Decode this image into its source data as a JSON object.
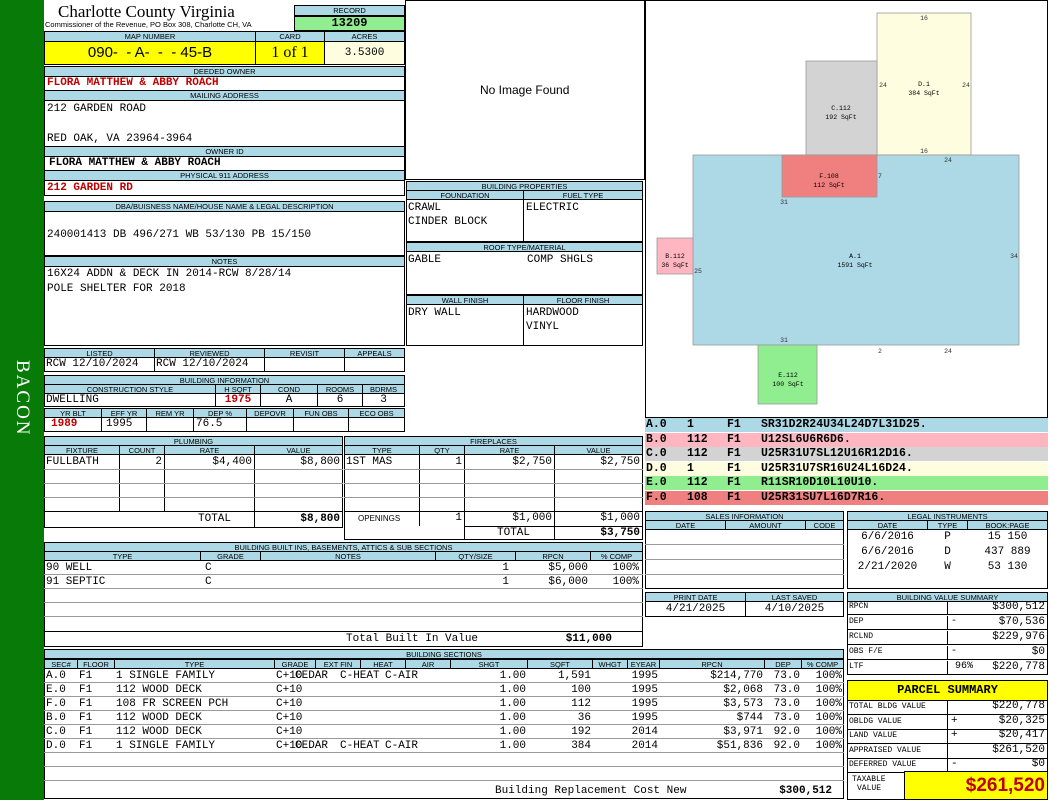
{
  "sidebar": {
    "label": "BACON"
  },
  "header": {
    "county": "Charlotte County Virginia",
    "address": "Commissioner of the Revenue, PO Box 308, Charlotte CH, VA",
    "record_label": "RECORD",
    "record": "13209"
  },
  "map": {
    "map_number_label": "MAP NUMBER",
    "map_number": "090-  - A-  -  - 45-B",
    "card_label": "CARD",
    "card": "1 of 1",
    "acres_label": "ACRES",
    "acres": "3.5300"
  },
  "deeded_owner": {
    "label": "DEEDED OWNER",
    "value": "FLORA MATTHEW & ABBY ROACH"
  },
  "mailing": {
    "label": "MAILING ADDRESS",
    "line1": "212 GARDEN ROAD",
    "line2": "RED OAK, VA 23964-3964"
  },
  "owner_id": {
    "label": "OWNER ID",
    "value": "FLORA MATTHEW & ABBY ROACH"
  },
  "physical": {
    "label": "PHYSICAL 911 ADDRESS",
    "value": "212 GARDEN RD"
  },
  "dba": {
    "label": "DBA/BUISNESS NAME/HOUSE NAME & LEGAL DESCRIPTION",
    "value": "240001413 DB 496/271 WB 53/130 PB 15/150"
  },
  "notes": {
    "label": "NOTES",
    "line1": "16X24 ADDN & DECK IN 2014-RCW 8/28/14",
    "line2": "POLE SHELTER FOR 2018"
  },
  "image": {
    "no_image": "No Image Found"
  },
  "building_props": {
    "label": "BUILDING PROPERTIES",
    "foundation_label": "FOUNDATION",
    "foundation": [
      "CRAWL",
      "CINDER BLOCK"
    ],
    "fuel_label": "FUEL TYPE",
    "fuel": "ELECTRIC",
    "roof_label": "ROOF TYPE/MATERIAL",
    "roof_type": "GABLE",
    "roof_material": "COMP SHGLS",
    "wall_label": "WALL FINISH",
    "wall": "DRY WALL",
    "floor_label": "FLOOR FINISH",
    "floor": [
      "HARDWOOD",
      "VINYL"
    ]
  },
  "review": {
    "listed_label": "LISTED",
    "listed": "RCW 12/10/2024",
    "reviewed_label": "REVIEWED",
    "reviewed": "RCW 12/10/2024",
    "revisit_label": "REVISIT",
    "appeals_label": "APPEALS"
  },
  "building_info": {
    "label": "BUILDING INFORMATION",
    "style_label": "CONSTRUCTION STYLE",
    "style": "DWELLING",
    "hsqft_label": "H SQFT",
    "hsqft": "1975",
    "cond_label": "COND",
    "cond": "A",
    "rooms_label": "ROOMS",
    "rooms": "6",
    "bdrms_label": "BDRMS",
    "bdrms": "3",
    "yrblt_label": "YR BLT",
    "yrblt": "1989",
    "effyr_label": "EFF YR",
    "effyr": "1995",
    "remyr_label": "REM YR",
    "dep_label": "DEP %",
    "dep": "76.5",
    "depovr_label": "DEPOVR",
    "funobs_label": "FUN OBS",
    "ecoobs_label": "ECO OBS"
  },
  "plumbing": {
    "label": "PLUMBING",
    "cols": [
      "FIXTURE",
      "COUNT",
      "RATE",
      "VALUE"
    ],
    "rows": [
      {
        "fixture": "FULLBATH",
        "count": "2",
        "rate": "$4,400",
        "value": "$8,800"
      }
    ],
    "total_label": "TOTAL",
    "total": "$8,800"
  },
  "fireplaces": {
    "label": "FIREPLACES",
    "cols": [
      "TYPE",
      "QTY",
      "RATE",
      "VALUE"
    ],
    "rows": [
      {
        "type": "1ST MAS",
        "qty": "1",
        "rate": "$2,750",
        "value": "$2,750"
      }
    ],
    "openings_label": "OPENINGS",
    "openings_qty": "1",
    "openings_rate": "$1,000",
    "openings_value": "$1,000",
    "total_label": "TOTAL",
    "total": "$3,750"
  },
  "builtins": {
    "label": "BUILDING BUILT INS, BASEMENTS, ATTICS & SUB SECTIONS",
    "cols": [
      "TYPE",
      "GRADE",
      "NOTES",
      "QTY/SIZE",
      "RPCN",
      "% COMP"
    ],
    "rows": [
      {
        "type": "90 WELL",
        "grade": "C",
        "notes": "",
        "qty": "1",
        "rpcn": "$5,000",
        "comp": "100%"
      },
      {
        "type": "91 SEPTIC",
        "grade": "C",
        "notes": "",
        "qty": "1",
        "rpcn": "$6,000",
        "comp": "100%"
      }
    ],
    "total_label": "Total Built In Value",
    "total": "$11,000"
  },
  "sections": {
    "label": "BUILDING SECTIONS",
    "cols": [
      "SEC#",
      "FLOOR",
      "TYPE",
      "GRADE",
      "EXT FIN",
      "HEAT",
      "AIR",
      "SHGT",
      "SQFT",
      "WHGT",
      "EYEAR",
      "RPCN",
      "DEP",
      "% COMP"
    ],
    "rows": [
      {
        "sec": "A.0",
        "floor": "F1",
        "type": "1 SINGLE FAMILY",
        "grade": "C+10",
        "ext": "CEDAR",
        "heat": "C-HEAT",
        "air": "C-AIR",
        "shgt": "1.00",
        "sqft": "1,591",
        "whgt": "",
        "eyear": "1995",
        "rpcn": "$214,770",
        "dep": "73.0",
        "comp": "100%"
      },
      {
        "sec": "E.0",
        "floor": "F1",
        "type": "112 WOOD DECK",
        "grade": "C+10",
        "ext": "",
        "heat": "",
        "air": "",
        "shgt": "1.00",
        "sqft": "100",
        "whgt": "",
        "eyear": "1995",
        "rpcn": "$2,068",
        "dep": "73.0",
        "comp": "100%"
      },
      {
        "sec": "F.0",
        "floor": "F1",
        "type": "108 FR SCREEN PCH",
        "grade": "C+10",
        "ext": "",
        "heat": "",
        "air": "",
        "shgt": "1.00",
        "sqft": "112",
        "whgt": "",
        "eyear": "1995",
        "rpcn": "$3,573",
        "dep": "73.0",
        "comp": "100%"
      },
      {
        "sec": "B.0",
        "floor": "F1",
        "type": "112 WOOD DECK",
        "grade": "C+10",
        "ext": "",
        "heat": "",
        "air": "",
        "shgt": "1.00",
        "sqft": "36",
        "whgt": "",
        "eyear": "1995",
        "rpcn": "$744",
        "dep": "73.0",
        "comp": "100%"
      },
      {
        "sec": "C.0",
        "floor": "F1",
        "type": "112 WOOD DECK",
        "grade": "C+10",
        "ext": "",
        "heat": "",
        "air": "",
        "shgt": "1.00",
        "sqft": "192",
        "whgt": "",
        "eyear": "2014",
        "rpcn": "$3,971",
        "dep": "92.0",
        "comp": "100%"
      },
      {
        "sec": "D.0",
        "floor": "F1",
        "type": "1 SINGLE FAMILY",
        "grade": "C+10",
        "ext": "CEDAR",
        "heat": "C-HEAT",
        "air": "C-AIR",
        "shgt": "1.00",
        "sqft": "384",
        "whgt": "",
        "eyear": "2014",
        "rpcn": "$51,836",
        "dep": "92.0",
        "comp": "100%"
      }
    ],
    "total_label": "Building Replacement Cost New",
    "total": "$300,512"
  },
  "sketch": {
    "areas": [
      {
        "id": "A.1",
        "sqft": "1591 SqFt",
        "color": "#add8e6"
      },
      {
        "id": "B.112",
        "sqft": "36 SqFt",
        "color": "#ffb6c1"
      },
      {
        "id": "C.112",
        "sqft": "192 SqFt",
        "color": "#d3d3d3"
      },
      {
        "id": "D.1",
        "sqft": "384 SqFt",
        "color": "#fffde0"
      },
      {
        "id": "E.112",
        "sqft": "100 SqFt",
        "color": "#90ee90"
      },
      {
        "id": "F.108",
        "sqft": "112 SqFt",
        "color": "#f08080"
      }
    ],
    "dims": {
      "d16a": "16",
      "d24a": "24",
      "d24b": "24",
      "d16b": "16",
      "d24c": "24",
      "d24d": "24",
      "d7": "7",
      "d31a": "31",
      "d34": "34",
      "d25": "25",
      "d31b": "31",
      "d2": "2",
      "d24e": "24"
    }
  },
  "segments": [
    {
      "sec": "A.0",
      "code": "1",
      "floor": "F1",
      "path": "SR31D2R24U34L24D7L31D25.",
      "color": "#add8e6"
    },
    {
      "sec": "B.0",
      "code": "112",
      "floor": "F1",
      "path": "U12SL6U6R6D6.",
      "color": "#ffb6c1"
    },
    {
      "sec": "C.0",
      "code": "112",
      "floor": "F1",
      "path": "U25R31U7SL12U16R12D16.",
      "color": "#d3d3d3"
    },
    {
      "sec": "D.0",
      "code": "1",
      "floor": "F1",
      "path": "U25R31U7SR16U24L16D24.",
      "color": "#fffde0"
    },
    {
      "sec": "E.0",
      "code": "112",
      "floor": "F1",
      "path": "R11SR10D10L10U10.",
      "color": "#90ee90"
    },
    {
      "sec": "F.0",
      "code": "108",
      "floor": "F1",
      "path": "U25R31SU7L16D7R16.",
      "color": "#f08080"
    }
  ],
  "sales": {
    "label": "SALES INFORMATION",
    "cols": [
      "DATE",
      "AMOUNT",
      "CODE"
    ]
  },
  "legal": {
    "label": "LEGAL INSTRUMENTS",
    "cols": [
      "DATE",
      "TYPE",
      "BOOK:PAGE"
    ],
    "rows": [
      {
        "date": "6/6/2016",
        "type": "P",
        "book": "15 150"
      },
      {
        "date": "6/6/2016",
        "type": "D",
        "book": "437 889"
      },
      {
        "date": "2/21/2020",
        "type": "W",
        "book": "53 130"
      }
    ]
  },
  "dates": {
    "print_label": "PRINT DATE",
    "print": "4/21/2025",
    "saved_label": "LAST SAVED",
    "saved": "4/10/2025"
  },
  "bvs": {
    "label": "BUILDING VALUE SUMMARY",
    "rows": [
      {
        "label": "RPCN",
        "sign": "",
        "value": "$300,512"
      },
      {
        "label": "DEP",
        "sign": "-",
        "value": "$70,536"
      },
      {
        "label": "RCLND",
        "sign": "",
        "value": "$229,976"
      },
      {
        "label": "OBS F/E",
        "sign": "-",
        "value": "$0"
      },
      {
        "label": "LTF",
        "sign": "96%",
        "value": "$220,778"
      }
    ]
  },
  "parcel": {
    "label": "PARCEL SUMMARY",
    "rows": [
      {
        "label": "TOTAL BLDG VALUE",
        "sign": "",
        "value": "$220,778"
      },
      {
        "label": "OBLDG VALUE",
        "sign": "+",
        "value": "$20,325"
      },
      {
        "label": "LAND VALUE",
        "sign": "+",
        "value": "$20,417"
      },
      {
        "label": "APPRAISED VALUE",
        "sign": "",
        "value": "$261,520"
      },
      {
        "label": "DEFERRED VALUE",
        "sign": "-",
        "value": "$0"
      }
    ],
    "taxable_label1": "TAXABLE",
    "taxable_label2": "VALUE",
    "taxable": "$261,520"
  }
}
